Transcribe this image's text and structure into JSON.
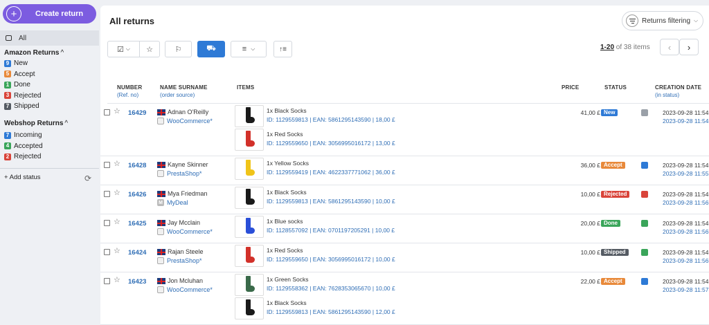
{
  "sidebar": {
    "create_button": "Create return",
    "all_label": "All",
    "amazon": {
      "title": "Amazon Returns",
      "items": [
        {
          "count": "9",
          "label": "New",
          "color": "#2e7ad6"
        },
        {
          "count": "5",
          "label": "Accept",
          "color": "#e8893a"
        },
        {
          "count": "1",
          "label": "Done",
          "color": "#3aa55a"
        },
        {
          "count": "3",
          "label": "Rejected",
          "color": "#d9443a"
        },
        {
          "count": "7",
          "label": "Shipped",
          "color": "#555b63"
        }
      ]
    },
    "webshop": {
      "title": "Webshop Returns",
      "items": [
        {
          "count": "7",
          "label": "Incoming",
          "color": "#2e7ad6"
        },
        {
          "count": "4",
          "label": "Accepted",
          "color": "#3aa55a"
        },
        {
          "count": "2",
          "label": "Rejected",
          "color": "#d9443a"
        }
      ]
    },
    "add_status": "+ Add status"
  },
  "header": {
    "title": "All returns",
    "filter_button": "Returns filtering"
  },
  "pager": {
    "range": "1-20",
    "rest": " of 38 items"
  },
  "columns": {
    "number": "NUMBER",
    "number_sub": "(Ref. no)",
    "name": "NAME SURNAME",
    "name_sub": "(order source)",
    "items": "ITEMS",
    "price": "PRICE",
    "status": "STATUS",
    "creation": "CREATION DATE",
    "creation_sub": "(in status)"
  },
  "rows": [
    {
      "number": "16429",
      "name": "Adnan O'Reilly",
      "source": "WooCommerce*",
      "source_icon": "box",
      "price": "41,00 £",
      "status": "New",
      "status_color": "#2e7ad6",
      "icon_color": "#9aa0a8",
      "date1": "2023-09-28 11:54",
      "date2": "2023-09-28 11:54",
      "items": [
        {
          "name": "1x Black Socks",
          "detail": "ID: 1129559813 | EAN: 5861295143590 | 18,00 £",
          "color": "#1a1a1a"
        },
        {
          "name": "1x Red Socks",
          "detail": "ID: 1129559650 | EAN: 3056995016172 | 13,00 £",
          "color": "#d2312a"
        }
      ]
    },
    {
      "number": "16428",
      "name": "Kayne Skinner",
      "source": "PrestaShop*",
      "source_icon": "box",
      "price": "36,00 £",
      "status": "Accept",
      "status_color": "#e8893a",
      "icon_color": "#2e7ad6",
      "date1": "2023-09-28 11:54",
      "date2": "2023-09-28 11:55",
      "items": [
        {
          "name": "1x Yellow Socks",
          "detail": "ID: 1129559419 | EAN: 4622337771062 | 36,00 £",
          "color": "#f0c419"
        }
      ]
    },
    {
      "number": "16426",
      "name": "Mya Friedman",
      "source": "MyDeal",
      "source_icon": "M",
      "price": "10,00 £",
      "status": "Rejected",
      "status_color": "#d9443a",
      "icon_color": "#d9443a",
      "date1": "2023-09-28 11:54",
      "date2": "2023-09-28 11:56",
      "items": [
        {
          "name": "1x Black Socks",
          "detail": "ID: 1129559813 | EAN: 5861295143590 | 10,00 £",
          "color": "#1a1a1a"
        }
      ]
    },
    {
      "number": "16425",
      "name": "Jay Mcclain",
      "source": "WooCommerce*",
      "source_icon": "box",
      "price": "20,00 £",
      "status": "Done",
      "status_color": "#3aa55a",
      "icon_color": "#3aa55a",
      "date1": "2023-09-28 11:54",
      "date2": "2023-09-28 11:56",
      "items": [
        {
          "name": "1x Blue socks",
          "detail": "ID: 1128557092 | EAN: 0701197205291 | 10,00 £",
          "color": "#2a4fd8"
        }
      ]
    },
    {
      "number": "16424",
      "name": "Rajan Steele",
      "source": "PrestaShop*",
      "source_icon": "box",
      "price": "10,00 £",
      "status": "Shipped",
      "status_color": "#555b63",
      "icon_color": "#3aa55a",
      "date1": "2023-09-28 11:54",
      "date2": "2023-09-28 11:56",
      "items": [
        {
          "name": "1x Red Socks",
          "detail": "ID: 1129559650 | EAN: 3056995016172 | 10,00 £",
          "color": "#d2312a"
        }
      ]
    },
    {
      "number": "16423",
      "name": "Jon Mcluhan",
      "source": "WooCommerce*",
      "source_icon": "box",
      "price": "22,00 £",
      "status": "Accept",
      "status_color": "#e8893a",
      "icon_color": "#2e7ad6",
      "date1": "2023-09-28 11:54",
      "date2": "2023-09-28 11:57",
      "items": [
        {
          "name": "1x Green Socks",
          "detail": "ID: 1129558362 | EAN: 7628353065670 | 10,00 £",
          "color": "#3a6a4a"
        },
        {
          "name": "1x Black Socks",
          "detail": "ID: 1129559813 | EAN: 5861295143590 | 12,00 £",
          "color": "#1a1a1a"
        }
      ]
    }
  ]
}
